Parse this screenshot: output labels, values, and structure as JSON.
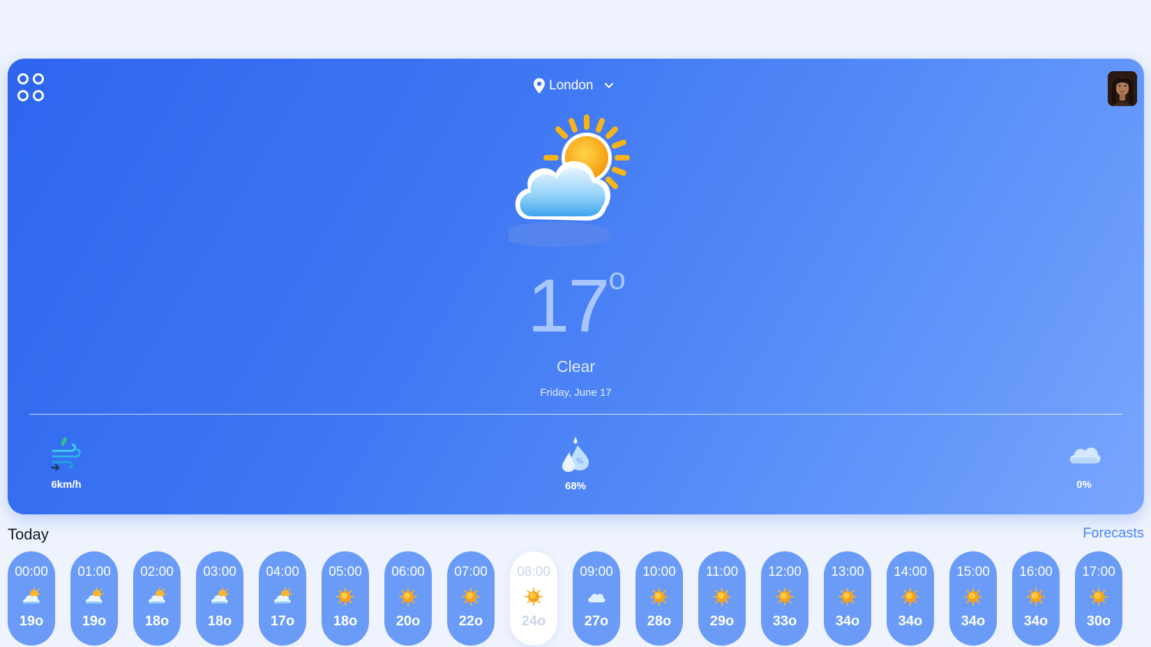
{
  "header": {
    "location": "London"
  },
  "current": {
    "temperature": "17",
    "degree_symbol": "o",
    "condition": "Clear",
    "date": "Friday, June 17",
    "icon": "partly-cloudy-sun-icon"
  },
  "stats": {
    "wind": "6km/h",
    "humidity": "68%",
    "cloud": "0%"
  },
  "today": {
    "label": "Today",
    "forecasts_label": "Forecasts",
    "hours": [
      {
        "time": "00:00",
        "temp": "19o",
        "icon": "partly-cloudy-sun-icon"
      },
      {
        "time": "01:00",
        "temp": "19o",
        "icon": "partly-cloudy-sun-icon"
      },
      {
        "time": "02:00",
        "temp": "18o",
        "icon": "partly-cloudy-sun-icon"
      },
      {
        "time": "03:00",
        "temp": "18o",
        "icon": "partly-cloudy-sun-icon"
      },
      {
        "time": "04:00",
        "temp": "17o",
        "icon": "partly-cloudy-sun-icon"
      },
      {
        "time": "05:00",
        "temp": "18o",
        "icon": "sun-icon"
      },
      {
        "time": "06:00",
        "temp": "20o",
        "icon": "sun-icon"
      },
      {
        "time": "07:00",
        "temp": "22o",
        "icon": "sun-icon"
      },
      {
        "time": "08:00",
        "temp": "24o",
        "icon": "sun-icon",
        "active": true
      },
      {
        "time": "09:00",
        "temp": "27o",
        "icon": "cloud-icon"
      },
      {
        "time": "10:00",
        "temp": "28o",
        "icon": "sun-icon"
      },
      {
        "time": "11:00",
        "temp": "29o",
        "icon": "sun-icon"
      },
      {
        "time": "12:00",
        "temp": "33o",
        "icon": "sun-icon"
      },
      {
        "time": "13:00",
        "temp": "34o",
        "icon": "sun-icon"
      },
      {
        "time": "14:00",
        "temp": "34o",
        "icon": "sun-icon"
      },
      {
        "time": "15:00",
        "temp": "34o",
        "icon": "sun-icon"
      },
      {
        "time": "16:00",
        "temp": "34o",
        "icon": "sun-icon"
      },
      {
        "time": "17:00",
        "temp": "30o",
        "icon": "sun-icon"
      }
    ]
  },
  "colors": {
    "card_start": "#2d65ef",
    "card_end": "#79a6fd",
    "hour_pill": "#6a9bf7",
    "accent_link": "#4d86f6",
    "page_bg": "#eef3fd"
  }
}
